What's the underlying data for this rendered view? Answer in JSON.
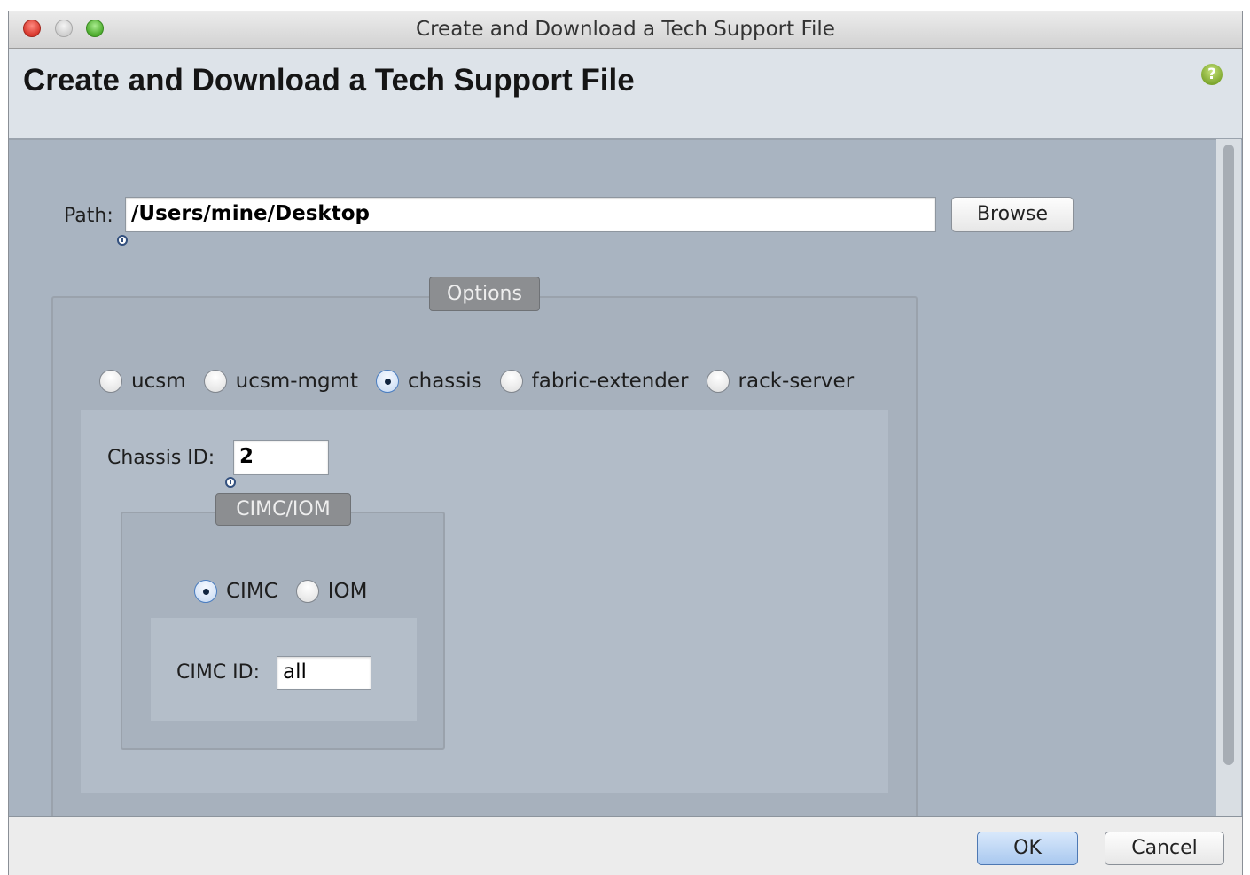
{
  "window": {
    "title": "Create and Download a Tech Support File"
  },
  "header": {
    "title": "Create and Download a Tech Support File",
    "help_icon": "?"
  },
  "path": {
    "label": "Path:",
    "value": "/Users/mine/Desktop",
    "browse_label": "Browse"
  },
  "options": {
    "legend": "Options",
    "radios": [
      {
        "label": "ucsm",
        "selected": false
      },
      {
        "label": "ucsm-mgmt",
        "selected": false
      },
      {
        "label": "chassis",
        "selected": true
      },
      {
        "label": "fabric-extender",
        "selected": false
      },
      {
        "label": "rack-server",
        "selected": false
      }
    ],
    "chassis_id": {
      "label": "Chassis ID:",
      "value": "2"
    },
    "cimc_iom": {
      "legend": "CIMC/IOM",
      "radios": [
        {
          "label": "CIMC",
          "selected": true
        },
        {
          "label": "IOM",
          "selected": false
        }
      ],
      "cimc_id": {
        "label": "CIMC ID:",
        "value": "all"
      }
    }
  },
  "footer": {
    "ok_label": "OK",
    "cancel_label": "Cancel"
  }
}
